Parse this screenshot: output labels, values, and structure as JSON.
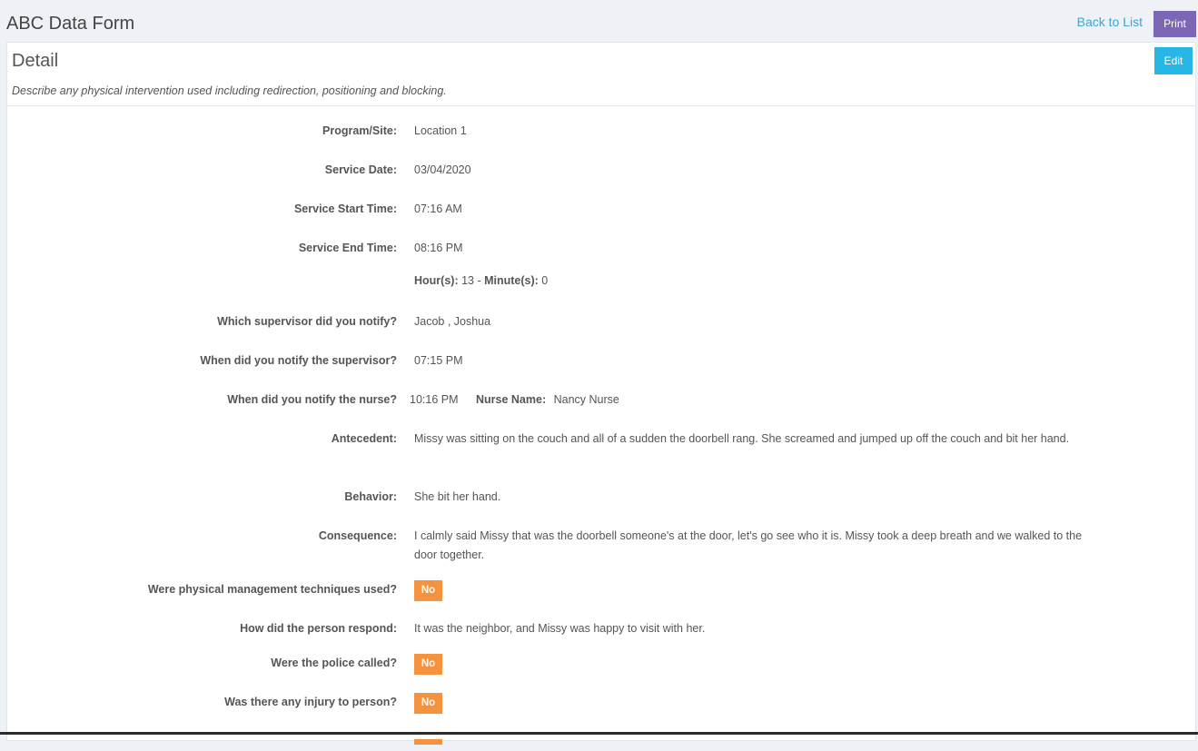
{
  "header": {
    "title": "ABC Data Form",
    "back_link": "Back to List",
    "print_label": "Print"
  },
  "detail": {
    "title": "Detail",
    "edit_label": "Edit",
    "subtitle": "Describe any physical intervention used including redirection, positioning and blocking.",
    "program_site": {
      "label": "Program/Site:",
      "value": "Location 1"
    },
    "service_date": {
      "label": "Service Date:",
      "value": "03/04/2020"
    },
    "start_time": {
      "label": "Service Start Time:",
      "value": "07:16 AM"
    },
    "end_time": {
      "label": "Service End Time:",
      "value": "08:16 PM"
    },
    "duration": {
      "hours_label": "Hour(s):",
      "hours_value": " 13 - ",
      "minutes_label": "Minute(s):",
      "minutes_value": " 0"
    },
    "supervisor": {
      "label": "Which supervisor did you notify?",
      "value": "Jacob , Joshua"
    },
    "supervisor_time": {
      "label": "When did you notify the supervisor?",
      "value": "07:15 PM"
    },
    "nurse": {
      "label": "When did you notify the nurse?",
      "time": "10:16 PM",
      "name_label": "Nurse Name:",
      "name_value": "Nancy Nurse"
    },
    "antecedent": {
      "label": "Antecedent:",
      "value": "Missy was sitting on the couch and all of a sudden the doorbell rang. She screamed and jumped up off the couch and bit her hand."
    },
    "behavior": {
      "label": "Behavior:",
      "value": "She bit her hand."
    },
    "consequence": {
      "label": "Consequence:",
      "value": "I calmly said Missy that was the doorbell someone's at the door, let's go see who it is. Missy took a deep breath and we walked to the door together."
    },
    "physical_mgmt": {
      "label": "Were physical management techniques used?",
      "value": "No"
    },
    "response": {
      "label": "How did the person respond:",
      "value": "It was the neighbor, and Missy was happy to visit with her."
    },
    "police": {
      "label": "Were the police called?",
      "value": "No"
    },
    "injury": {
      "label": "Was there any injury to person?",
      "value": "No"
    }
  },
  "colors": {
    "print_button": "#7c67b7",
    "edit_button": "#27b7e6",
    "no_badge": "#f5923e",
    "link": "#3aa5d8"
  }
}
